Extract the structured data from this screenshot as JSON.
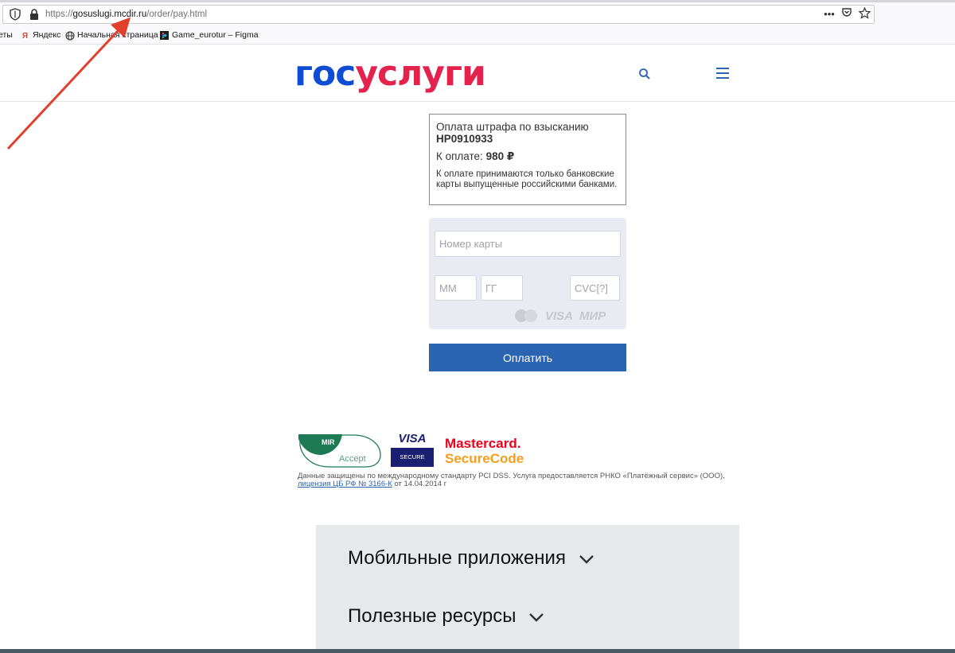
{
  "browser": {
    "url_prefix": "https://",
    "url_host": "gosuslugi.mcdir.ru",
    "url_path": "/order/pay.html",
    "more_label": "•••"
  },
  "bookmarks": [
    {
      "label": "еты"
    },
    {
      "label": "Яндекс"
    },
    {
      "label": "Начальная страница"
    },
    {
      "label": "Game_eurotur – Figma"
    }
  ],
  "header": {
    "logo_part1": "гос",
    "logo_part2": "услуги"
  },
  "payment": {
    "title": "Оплата штрафа по взысканию",
    "code": "НР0910933",
    "amount_label": "К оплате:",
    "amount_value": "980 ₽",
    "note": "К оплате принимаются только банковские карты выпущенные российскими банками."
  },
  "form": {
    "card_placeholder": "Номер карты",
    "mm_placeholder": "ММ",
    "yy_placeholder": "ГГ",
    "cvc_placeholder": "CVC[?]",
    "brand_visa": "VISA",
    "brand_mir": "МИР",
    "pay_label": "Оплатить"
  },
  "security": {
    "mir_top": "MIR",
    "mir_bottom": "Accept",
    "visa_top": "VISA",
    "visa_bottom": "SECURE",
    "mc_line1": "Mastercard.",
    "mc_line2": "SecureCode",
    "legal_text": "Данные защищены по международному стандарту PCI DSS. Услуга предоставляется РНКО «Платёжный сервис» (ООО),",
    "legal_link": "лицензия ЦБ РФ № 3166-К",
    "legal_tail": "от 14.04.2014 г"
  },
  "footer": {
    "items": [
      {
        "label": "Мобильные приложения"
      },
      {
        "label": "Полезные ресурсы"
      }
    ]
  },
  "colors": {
    "logo_blue": "#0d4cd3",
    "logo_red": "#e3224e",
    "button_blue": "#2b64b1",
    "annotation_arrow": "#e2402d"
  }
}
